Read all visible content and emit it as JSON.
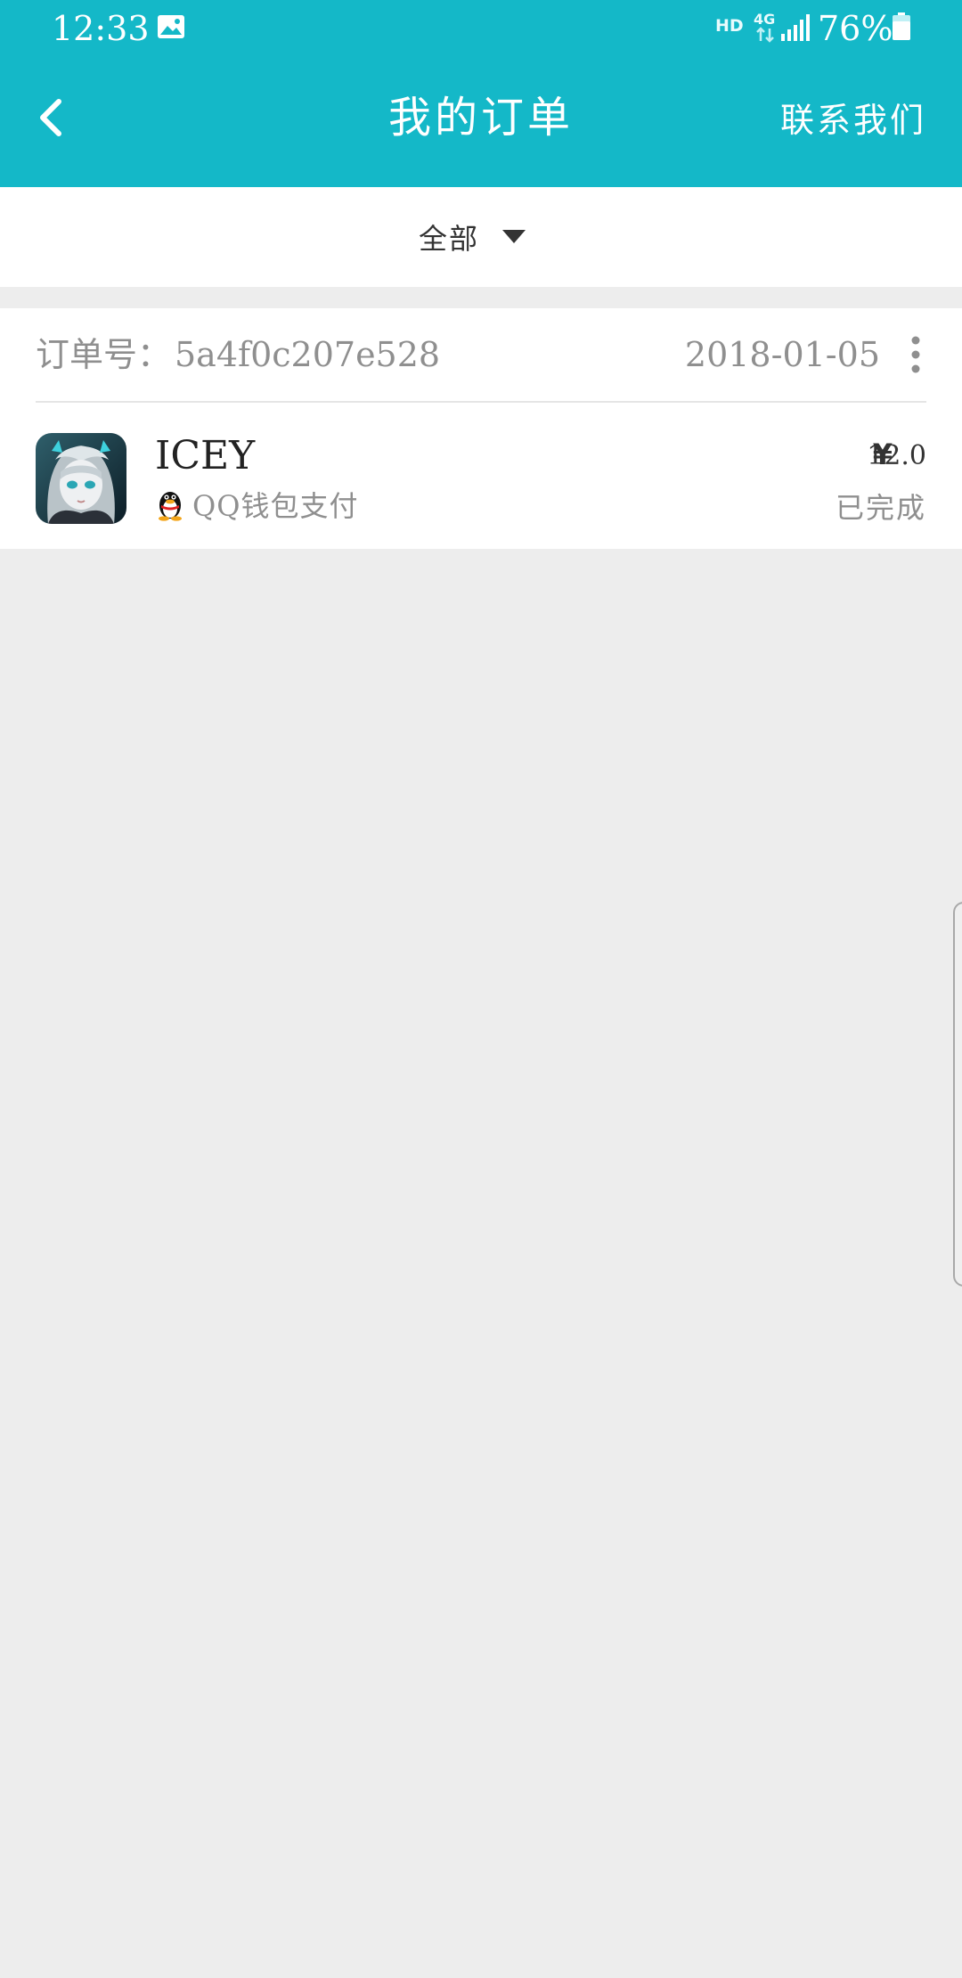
{
  "status_bar": {
    "time": "12:33",
    "hd": "HD",
    "network": "4G",
    "battery_percent": "76%",
    "icons": [
      "image-icon",
      "signal-icon",
      "battery-icon"
    ]
  },
  "header": {
    "title": "我的订单",
    "contact_label": "联系我们",
    "back_icon": "chevron-left-icon"
  },
  "filter": {
    "selected": "全部",
    "caret_icon": "caret-down-icon"
  },
  "orders": [
    {
      "order_no_label": "订单号：",
      "order_no": "5a4f0c207e528",
      "date": "2018-01-05",
      "product_name": "ICEY",
      "payment_method": "QQ钱包支付",
      "currency_symbol": "¥",
      "price": "12.0",
      "status": "已完成"
    }
  ],
  "colors": {
    "primary": "#14b8c8",
    "background": "#ededed",
    "card": "#ffffff",
    "text_secondary": "#8f8f8f",
    "text_primary": "#222222"
  }
}
